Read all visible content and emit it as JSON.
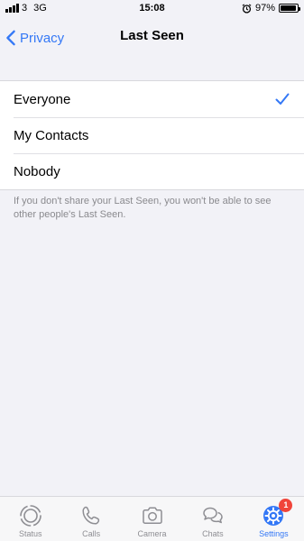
{
  "status_bar": {
    "carrier": "3",
    "network": "3G",
    "time": "15:08",
    "battery": "97%",
    "battery_level": 0.97
  },
  "navbar": {
    "back_label": "Privacy",
    "title": "Last Seen"
  },
  "options": [
    {
      "label": "Everyone",
      "selected": true
    },
    {
      "label": "My Contacts",
      "selected": false
    },
    {
      "label": "Nobody",
      "selected": false
    }
  ],
  "footnote": "If you don't share your Last Seen, you won't be able to see other people's Last Seen.",
  "tabbar": {
    "tabs": [
      {
        "label": "Status",
        "icon": "status-icon"
      },
      {
        "label": "Calls",
        "icon": "phone-icon"
      },
      {
        "label": "Camera",
        "icon": "camera-icon"
      },
      {
        "label": "Chats",
        "icon": "chat-bubbles-icon"
      },
      {
        "label": "Settings",
        "icon": "gear-icon",
        "active": true,
        "badge": "1"
      }
    ]
  },
  "colors": {
    "accent": "#3478f6",
    "background": "#f2f2f7",
    "badge": "#f0443a"
  }
}
